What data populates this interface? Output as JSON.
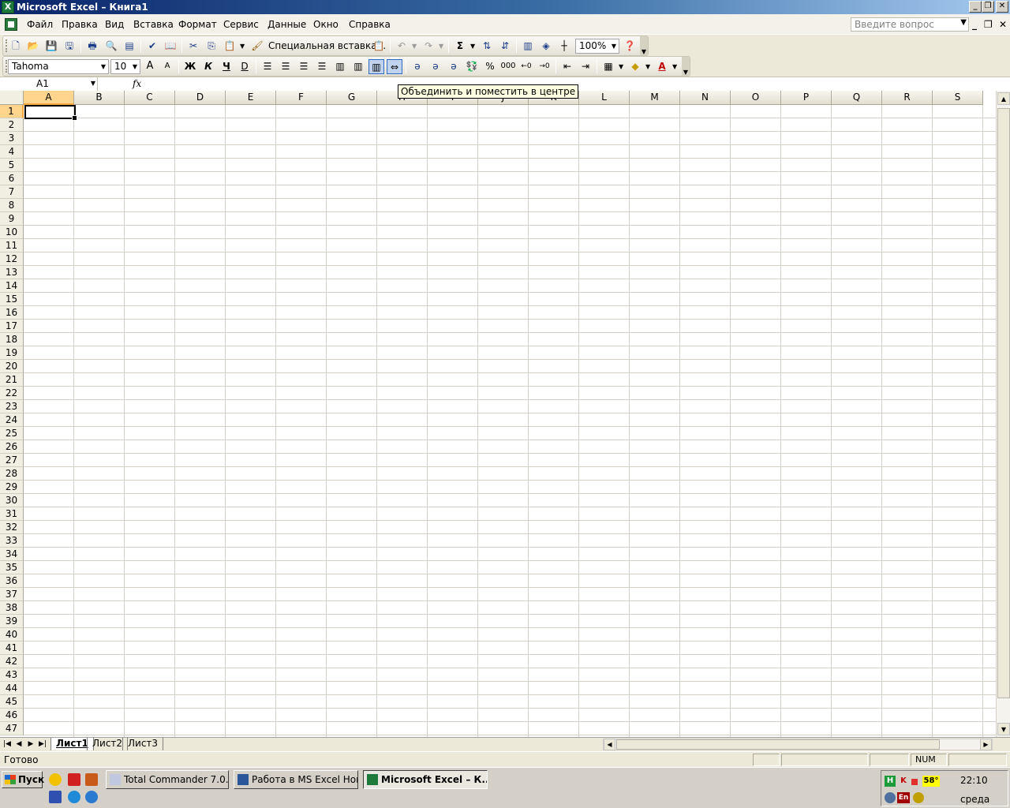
{
  "window": {
    "title": "Microsoft Excel – Книга1",
    "minimize": "_",
    "restore": "❐",
    "close": "✕"
  },
  "menu": {
    "items": [
      "Файл",
      "Правка",
      "Вид",
      "Вставка",
      "Формат",
      "Сервис",
      "Данные",
      "Окно",
      "Справка"
    ],
    "help_placeholder": "Введите вопрос",
    "doc_minimize": "_",
    "doc_restore": "❐",
    "doc_close": "✕"
  },
  "standard_toolbar": {
    "paste_special_label": "Специальная вставка...",
    "sum_symbol": "Σ",
    "zoom": "100%"
  },
  "format_toolbar": {
    "font": "Tahoma",
    "font_size": "10",
    "bold": "Ж",
    "italic": "К",
    "underline": "Ч",
    "strike": "D",
    "percent": "%",
    "thousands": "000",
    "grow_font": "A",
    "shrink_font": "A",
    "font_color_letter": "A"
  },
  "formula_bar": {
    "name_box": "A1",
    "fx": "fx",
    "formula": ""
  },
  "tooltip": "Объединить и поместить в центре",
  "sheet": {
    "columns": [
      "A",
      "B",
      "C",
      "D",
      "E",
      "F",
      "G",
      "H",
      "I",
      "J",
      "K",
      "L",
      "M",
      "N",
      "O",
      "P",
      "Q",
      "R",
      "S"
    ],
    "rows": [
      "1",
      "2",
      "3",
      "4",
      "5",
      "6",
      "7",
      "8",
      "9",
      "10",
      "11",
      "12",
      "13",
      "14",
      "15",
      "16",
      "17",
      "18",
      "19",
      "20",
      "21",
      "22",
      "23",
      "24",
      "25",
      "26",
      "27",
      "28",
      "29",
      "30",
      "31",
      "32",
      "33",
      "34",
      "35",
      "36",
      "37",
      "38",
      "39",
      "40",
      "41",
      "42",
      "43",
      "44",
      "45",
      "46",
      "47"
    ],
    "active_column": "A",
    "active_row": "1",
    "tabs": [
      "Лист1",
      "Лист2",
      "Лист3"
    ],
    "active_tab": "Лист1"
  },
  "status": {
    "text": "Готово",
    "num": "NUM"
  },
  "taskbar": {
    "start": "Пуск",
    "tasks": [
      {
        "label": "Total Commander 7.0...",
        "active": false
      },
      {
        "label": "Работа в  MS Excel Нов...",
        "active": false
      },
      {
        "label": "Microsoft Excel – К...",
        "active": true
      }
    ],
    "tray": {
      "time": "22:10",
      "weekday": "среда",
      "temperature": "58°",
      "lang": "En"
    }
  },
  "colors": {
    "title_gradient_start": "#0a246a",
    "title_gradient_end": "#a6caf0",
    "selected_header": "#ffd58d",
    "tooltip_bg": "#ffffe1",
    "excel_green": "#1d7a3a"
  }
}
